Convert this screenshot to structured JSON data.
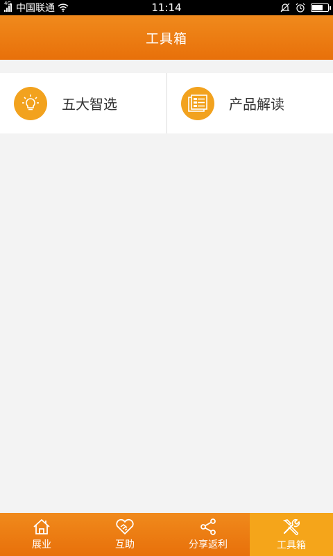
{
  "status_bar": {
    "network": "4G",
    "carrier": "中国联通",
    "time": "11:14",
    "battery_level": 0.7
  },
  "header": {
    "title": "工具箱"
  },
  "tools": [
    {
      "label": "五大智选",
      "icon": "lightbulb-icon"
    },
    {
      "label": "产品解读",
      "icon": "document-list-icon"
    }
  ],
  "bottom_nav": {
    "active_index": 3,
    "items": [
      {
        "label": "展业",
        "icon": "home-icon"
      },
      {
        "label": "互助",
        "icon": "heart-handshake-icon"
      },
      {
        "label": "分享返利",
        "icon": "share-icon"
      },
      {
        "label": "工具箱",
        "icon": "tools-icon"
      }
    ]
  },
  "colors": {
    "brand_orange": "#e8700a",
    "active_tab": "#f5a51a",
    "icon_circle": "#f2a21e",
    "background": "#f3f3f3"
  }
}
